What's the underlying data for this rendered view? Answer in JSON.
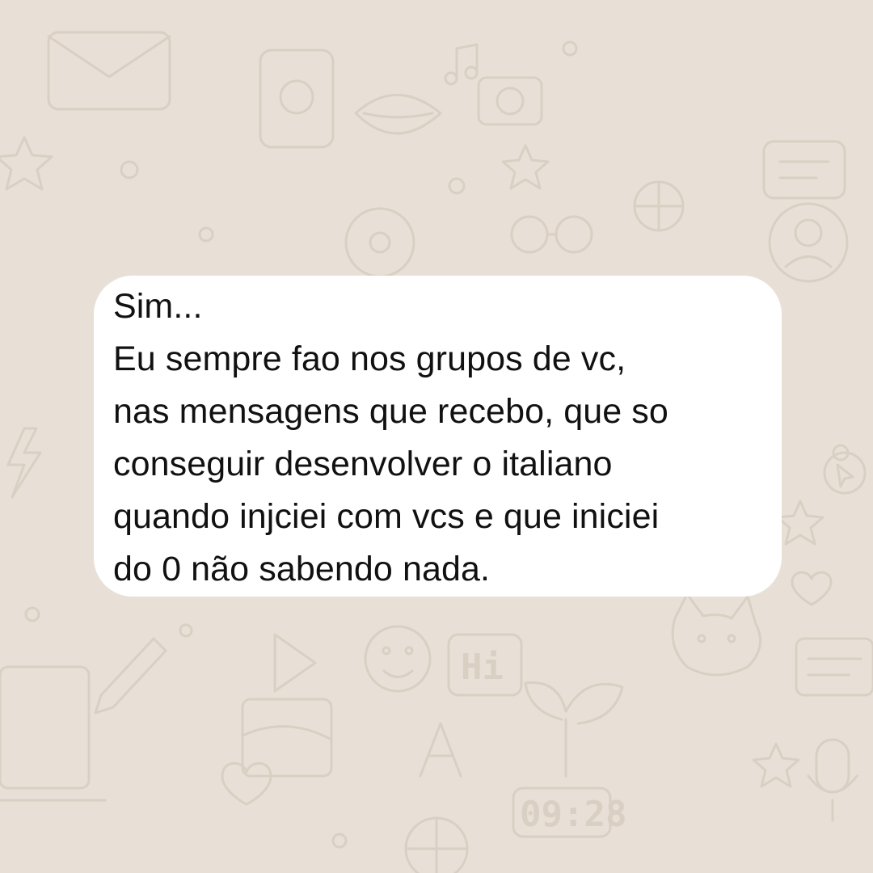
{
  "chat": {
    "message": {
      "lines": [
        "Sim...",
        "Eu sempre fao nos grupos de vc,",
        "nas mensagens que recebo, que so",
        "conseguir desenvolver o italiano",
        "quando injciei com vcs e que iniciei",
        "do 0 não sabendo nada."
      ]
    },
    "wallpaper": {
      "clock_text": "09:28",
      "hi_text": "Hi"
    }
  },
  "colors": {
    "wallpaper": "#e8e0d6",
    "doodle": "#d9cfc3",
    "bubble": "#ffffff",
    "text": "#111111"
  }
}
